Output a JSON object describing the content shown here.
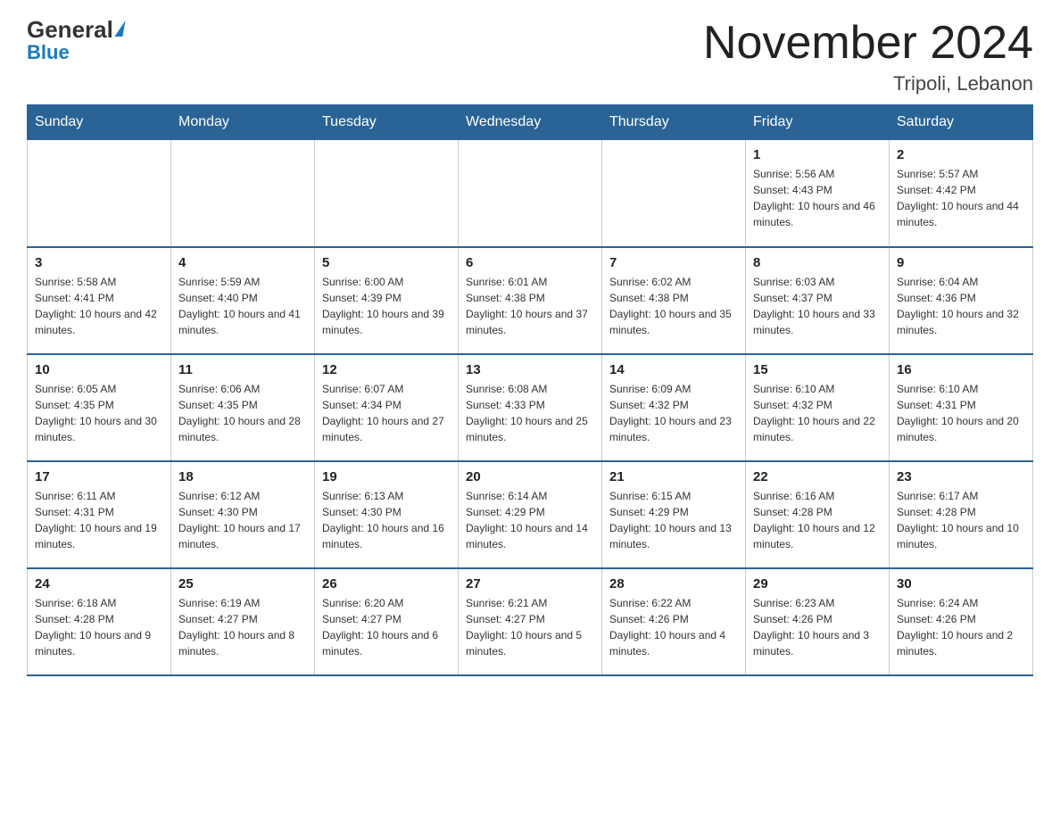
{
  "logo": {
    "text1": "General",
    "text2": "Blue"
  },
  "title": "November 2024",
  "location": "Tripoli, Lebanon",
  "days_of_week": [
    "Sunday",
    "Monday",
    "Tuesday",
    "Wednesday",
    "Thursday",
    "Friday",
    "Saturday"
  ],
  "weeks": [
    [
      {
        "day": "",
        "info": ""
      },
      {
        "day": "",
        "info": ""
      },
      {
        "day": "",
        "info": ""
      },
      {
        "day": "",
        "info": ""
      },
      {
        "day": "",
        "info": ""
      },
      {
        "day": "1",
        "info": "Sunrise: 5:56 AM\nSunset: 4:43 PM\nDaylight: 10 hours and 46 minutes."
      },
      {
        "day": "2",
        "info": "Sunrise: 5:57 AM\nSunset: 4:42 PM\nDaylight: 10 hours and 44 minutes."
      }
    ],
    [
      {
        "day": "3",
        "info": "Sunrise: 5:58 AM\nSunset: 4:41 PM\nDaylight: 10 hours and 42 minutes."
      },
      {
        "day": "4",
        "info": "Sunrise: 5:59 AM\nSunset: 4:40 PM\nDaylight: 10 hours and 41 minutes."
      },
      {
        "day": "5",
        "info": "Sunrise: 6:00 AM\nSunset: 4:39 PM\nDaylight: 10 hours and 39 minutes."
      },
      {
        "day": "6",
        "info": "Sunrise: 6:01 AM\nSunset: 4:38 PM\nDaylight: 10 hours and 37 minutes."
      },
      {
        "day": "7",
        "info": "Sunrise: 6:02 AM\nSunset: 4:38 PM\nDaylight: 10 hours and 35 minutes."
      },
      {
        "day": "8",
        "info": "Sunrise: 6:03 AM\nSunset: 4:37 PM\nDaylight: 10 hours and 33 minutes."
      },
      {
        "day": "9",
        "info": "Sunrise: 6:04 AM\nSunset: 4:36 PM\nDaylight: 10 hours and 32 minutes."
      }
    ],
    [
      {
        "day": "10",
        "info": "Sunrise: 6:05 AM\nSunset: 4:35 PM\nDaylight: 10 hours and 30 minutes."
      },
      {
        "day": "11",
        "info": "Sunrise: 6:06 AM\nSunset: 4:35 PM\nDaylight: 10 hours and 28 minutes."
      },
      {
        "day": "12",
        "info": "Sunrise: 6:07 AM\nSunset: 4:34 PM\nDaylight: 10 hours and 27 minutes."
      },
      {
        "day": "13",
        "info": "Sunrise: 6:08 AM\nSunset: 4:33 PM\nDaylight: 10 hours and 25 minutes."
      },
      {
        "day": "14",
        "info": "Sunrise: 6:09 AM\nSunset: 4:32 PM\nDaylight: 10 hours and 23 minutes."
      },
      {
        "day": "15",
        "info": "Sunrise: 6:10 AM\nSunset: 4:32 PM\nDaylight: 10 hours and 22 minutes."
      },
      {
        "day": "16",
        "info": "Sunrise: 6:10 AM\nSunset: 4:31 PM\nDaylight: 10 hours and 20 minutes."
      }
    ],
    [
      {
        "day": "17",
        "info": "Sunrise: 6:11 AM\nSunset: 4:31 PM\nDaylight: 10 hours and 19 minutes."
      },
      {
        "day": "18",
        "info": "Sunrise: 6:12 AM\nSunset: 4:30 PM\nDaylight: 10 hours and 17 minutes."
      },
      {
        "day": "19",
        "info": "Sunrise: 6:13 AM\nSunset: 4:30 PM\nDaylight: 10 hours and 16 minutes."
      },
      {
        "day": "20",
        "info": "Sunrise: 6:14 AM\nSunset: 4:29 PM\nDaylight: 10 hours and 14 minutes."
      },
      {
        "day": "21",
        "info": "Sunrise: 6:15 AM\nSunset: 4:29 PM\nDaylight: 10 hours and 13 minutes."
      },
      {
        "day": "22",
        "info": "Sunrise: 6:16 AM\nSunset: 4:28 PM\nDaylight: 10 hours and 12 minutes."
      },
      {
        "day": "23",
        "info": "Sunrise: 6:17 AM\nSunset: 4:28 PM\nDaylight: 10 hours and 10 minutes."
      }
    ],
    [
      {
        "day": "24",
        "info": "Sunrise: 6:18 AM\nSunset: 4:28 PM\nDaylight: 10 hours and 9 minutes."
      },
      {
        "day": "25",
        "info": "Sunrise: 6:19 AM\nSunset: 4:27 PM\nDaylight: 10 hours and 8 minutes."
      },
      {
        "day": "26",
        "info": "Sunrise: 6:20 AM\nSunset: 4:27 PM\nDaylight: 10 hours and 6 minutes."
      },
      {
        "day": "27",
        "info": "Sunrise: 6:21 AM\nSunset: 4:27 PM\nDaylight: 10 hours and 5 minutes."
      },
      {
        "day": "28",
        "info": "Sunrise: 6:22 AM\nSunset: 4:26 PM\nDaylight: 10 hours and 4 minutes."
      },
      {
        "day": "29",
        "info": "Sunrise: 6:23 AM\nSunset: 4:26 PM\nDaylight: 10 hours and 3 minutes."
      },
      {
        "day": "30",
        "info": "Sunrise: 6:24 AM\nSunset: 4:26 PM\nDaylight: 10 hours and 2 minutes."
      }
    ]
  ]
}
